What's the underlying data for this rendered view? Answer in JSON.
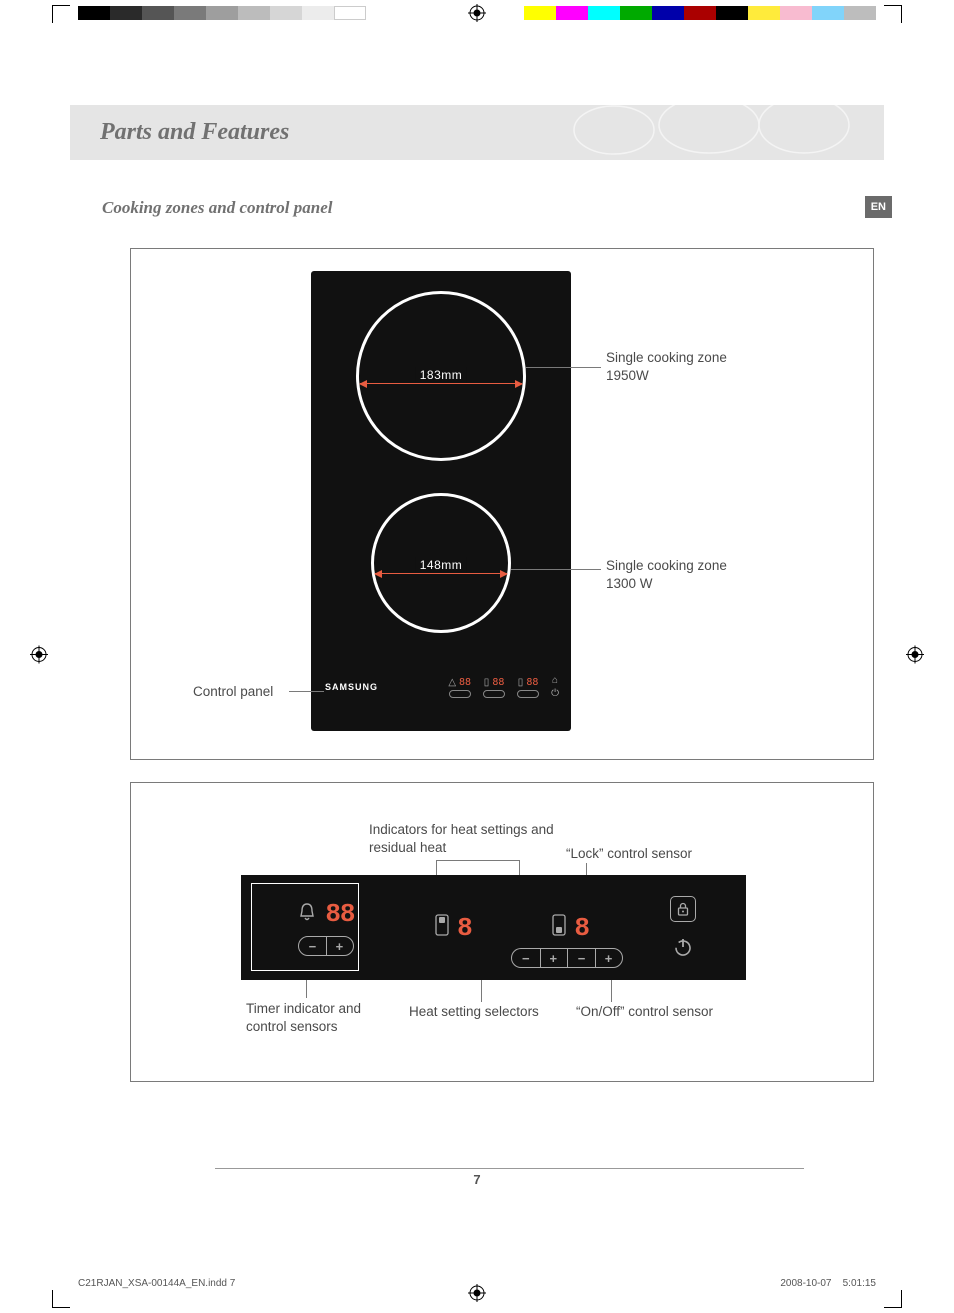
{
  "meta": {
    "section_title": "Parts and Features",
    "subheading": "Cooking zones and control panel",
    "lang_badge": "EN",
    "page_number": "7"
  },
  "figure1": {
    "brand": "SAMSUNG",
    "zone1_dim": "183mm",
    "zone2_dim": "148mm",
    "label_zone1_line1": "Single cooking zone",
    "label_zone1_line2": "1950W",
    "label_zone2_line1": "Single cooking zone",
    "label_zone2_line2": "1300 W",
    "label_control_panel": "Control panel",
    "mini_digits": "88"
  },
  "figure2": {
    "timer_digits": "88",
    "heat_digit": "8",
    "label_indicators": "Indicators for heat settings and residual heat",
    "label_lock": "“Lock” control sensor",
    "label_timer": "Timer indicator and control sensors",
    "label_heat_selectors": "Heat setting selectors",
    "label_onoff": "“On/Off” control sensor"
  },
  "footer": {
    "file": "C21RJAN_XSA-00144A_EN.indd   7",
    "date": "2008-10-07",
    "time": "5:01:15"
  }
}
